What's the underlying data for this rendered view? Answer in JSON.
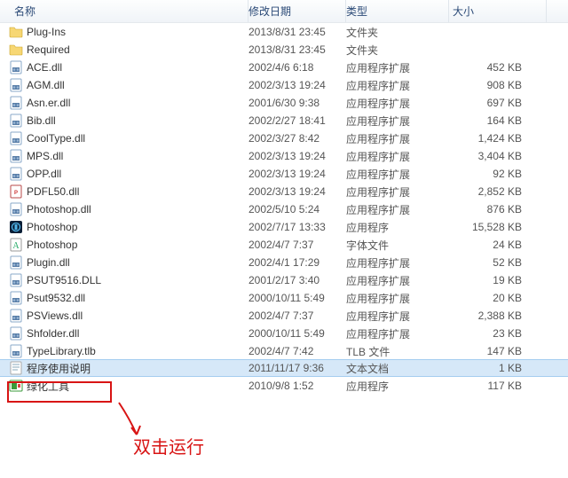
{
  "columns": {
    "name": "名称",
    "date": "修改日期",
    "type": "类型",
    "size": "大小"
  },
  "rows": [
    {
      "icon": "folder",
      "name": "Plug-Ins",
      "date": "2013/8/31 23:45",
      "type": "文件夹",
      "size": ""
    },
    {
      "icon": "folder",
      "name": "Required",
      "date": "2013/8/31 23:45",
      "type": "文件夹",
      "size": ""
    },
    {
      "icon": "dll",
      "name": "ACE.dll",
      "date": "2002/4/6 6:18",
      "type": "应用程序扩展",
      "size": "452 KB"
    },
    {
      "icon": "dll",
      "name": "AGM.dll",
      "date": "2002/3/13 19:24",
      "type": "应用程序扩展",
      "size": "908 KB"
    },
    {
      "icon": "dll",
      "name": "Asn.er.dll",
      "date": "2001/6/30 9:38",
      "type": "应用程序扩展",
      "size": "697 KB"
    },
    {
      "icon": "dll",
      "name": "Bib.dll",
      "date": "2002/2/27 18:41",
      "type": "应用程序扩展",
      "size": "164 KB"
    },
    {
      "icon": "dll",
      "name": "CoolType.dll",
      "date": "2002/3/27 8:42",
      "type": "应用程序扩展",
      "size": "1,424 KB"
    },
    {
      "icon": "dll",
      "name": "MPS.dll",
      "date": "2002/3/13 19:24",
      "type": "应用程序扩展",
      "size": "3,404 KB"
    },
    {
      "icon": "dll",
      "name": "OPP.dll",
      "date": "2002/3/13 19:24",
      "type": "应用程序扩展",
      "size": "92 KB"
    },
    {
      "icon": "pdf",
      "name": "PDFL50.dll",
      "date": "2002/3/13 19:24",
      "type": "应用程序扩展",
      "size": "2,852 KB"
    },
    {
      "icon": "dll",
      "name": "Photoshop.dll",
      "date": "2002/5/10 5:24",
      "type": "应用程序扩展",
      "size": "876 KB"
    },
    {
      "icon": "ps",
      "name": "Photoshop",
      "date": "2002/7/17 13:33",
      "type": "应用程序",
      "size": "15,528 KB"
    },
    {
      "icon": "font",
      "name": "Photoshop",
      "date": "2002/4/7 7:37",
      "type": "字体文件",
      "size": "24 KB"
    },
    {
      "icon": "dll",
      "name": "Plugin.dll",
      "date": "2002/4/1 17:29",
      "type": "应用程序扩展",
      "size": "52 KB"
    },
    {
      "icon": "dll",
      "name": "PSUT9516.DLL",
      "date": "2001/2/17 3:40",
      "type": "应用程序扩展",
      "size": "19 KB"
    },
    {
      "icon": "dll",
      "name": "Psut9532.dll",
      "date": "2000/10/11 5:49",
      "type": "应用程序扩展",
      "size": "20 KB"
    },
    {
      "icon": "dll",
      "name": "PSViews.dll",
      "date": "2002/4/7 7:37",
      "type": "应用程序扩展",
      "size": "2,388 KB"
    },
    {
      "icon": "dll",
      "name": "Shfolder.dll",
      "date": "2000/10/11 5:49",
      "type": "应用程序扩展",
      "size": "23 KB"
    },
    {
      "icon": "dll",
      "name": "TypeLibrary.tlb",
      "date": "2002/4/7 7:42",
      "type": "TLB 文件",
      "size": "147 KB"
    },
    {
      "icon": "txt",
      "name": "程序使用说明",
      "date": "2011/11/17 9:36",
      "type": "文本文档",
      "size": "1 KB",
      "selected": true
    },
    {
      "icon": "green",
      "name": "绿化工具",
      "date": "2010/9/8 1:52",
      "type": "应用程序",
      "size": "117 KB"
    }
  ],
  "annotation": "双击运行"
}
